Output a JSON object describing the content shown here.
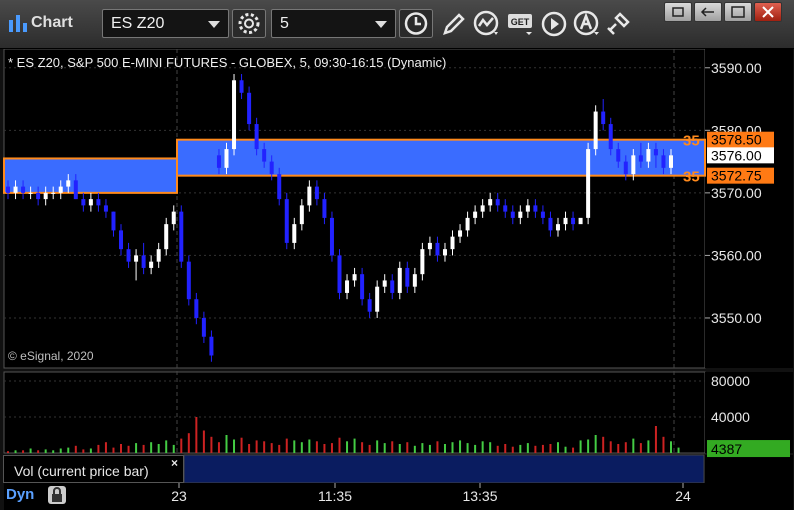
{
  "toolbar": {
    "app_title": "Chart",
    "symbol_value": "ES Z20",
    "interval_value": "5",
    "icons": [
      "chart-logo-icon",
      "settings-gear-icon",
      "clock-icon",
      "pencil-icon",
      "study-icon",
      "get-icon",
      "play-icon",
      "alert-icon",
      "link-icon"
    ]
  },
  "window_controls": [
    "restore-icon",
    "maximize-icon",
    "close-icon"
  ],
  "chart": {
    "symbol_title": "* ES Z20, S&P 500 E-MINI FUTURES - GLOBEX, 5, 09:30-16:15 (Dynamic)",
    "copyright": "© eSignal, 2020",
    "price_ticks": [
      "3590.00",
      "3580.00",
      "3570.00",
      "3560.00",
      "3550.00"
    ],
    "price_tag_high": "3578.50",
    "price_tag_current": "3576.00",
    "price_tag_low": "3572.75",
    "tag_prefix_high": "35",
    "tag_prefix_low": "35",
    "volume_ticks": [
      "80000",
      "40000"
    ],
    "volume_current": "4387",
    "time_labels": [
      "23",
      "11:35",
      "13:35",
      "24"
    ],
    "colors": {
      "up": "#ffffff",
      "down": "#2222ff",
      "band": "#3a6cff",
      "band_border": "#ff8a1c",
      "vol_up": "#44cc44",
      "vol_down": "#cc2222",
      "vol_tag": "#33aa22"
    }
  },
  "chart_data": {
    "type": "candlestick",
    "ylim": [
      3542,
      3593
    ],
    "candles": [
      [
        3571,
        3572,
        3569,
        3570
      ],
      [
        3570,
        3572,
        3569,
        3571
      ],
      [
        3571,
        3572,
        3569,
        3570
      ],
      [
        3570,
        3571,
        3569,
        3570
      ],
      [
        3570,
        3571,
        3568,
        3569
      ],
      [
        3569,
        3571,
        3568,
        3570
      ],
      [
        3570,
        3571,
        3569,
        3570
      ],
      [
        3570,
        3572,
        3569,
        3571
      ],
      [
        3571,
        3573,
        3570,
        3572
      ],
      [
        3572,
        3573,
        3569,
        3569
      ],
      [
        3569,
        3570,
        3567,
        3568
      ],
      [
        3568,
        3570,
        3567,
        3569
      ],
      [
        3569,
        3570,
        3567,
        3568
      ],
      [
        3568,
        3569,
        3566,
        3567
      ],
      [
        3567,
        3567,
        3563,
        3564
      ],
      [
        3564,
        3565,
        3560,
        3561
      ],
      [
        3561,
        3562,
        3558,
        3559
      ],
      [
        3559,
        3561,
        3556,
        3560
      ],
      [
        3560,
        3562,
        3557,
        3558
      ],
      [
        3558,
        3560,
        3557,
        3559
      ],
      [
        3559,
        3562,
        3558,
        3561
      ],
      [
        3561,
        3566,
        3560,
        3565
      ],
      [
        3565,
        3568,
        3564,
        3567
      ],
      [
        3567,
        3568,
        3558,
        3559
      ],
      [
        3559,
        3560,
        3552,
        3553
      ],
      [
        3553,
        3554,
        3549,
        3550
      ],
      [
        3550,
        3551,
        3546,
        3547
      ],
      [
        3547,
        3548,
        3543,
        3544
      ],
      [
        3576,
        3577,
        3573,
        3574
      ],
      [
        3574,
        3578,
        3573,
        3577
      ],
      [
        3577,
        3589,
        3576,
        3588
      ],
      [
        3588,
        3589,
        3585,
        3586
      ],
      [
        3586,
        3587,
        3580,
        3581
      ],
      [
        3581,
        3582,
        3576,
        3577
      ],
      [
        3577,
        3578,
        3574,
        3575
      ],
      [
        3575,
        3576,
        3572,
        3573
      ],
      [
        3573,
        3574,
        3568,
        3569
      ],
      [
        3569,
        3570,
        3561,
        3562
      ],
      [
        3562,
        3566,
        3561,
        3565
      ],
      [
        3565,
        3569,
        3564,
        3568
      ],
      [
        3568,
        3572,
        3567,
        3571
      ],
      [
        3571,
        3572,
        3568,
        3569
      ],
      [
        3569,
        3570,
        3565,
        3566
      ],
      [
        3566,
        3567,
        3559,
        3560
      ],
      [
        3560,
        3561,
        3553,
        3554
      ],
      [
        3554,
        3557,
        3553,
        3556
      ],
      [
        3556,
        3558,
        3555,
        3557
      ],
      [
        3557,
        3558,
        3552,
        3553
      ],
      [
        3553,
        3554,
        3550,
        3551
      ],
      [
        3551,
        3556,
        3550,
        3555
      ],
      [
        3555,
        3557,
        3554,
        3556
      ],
      [
        3556,
        3557,
        3553,
        3554
      ],
      [
        3554,
        3559,
        3553,
        3558
      ],
      [
        3558,
        3559,
        3554,
        3555
      ],
      [
        3555,
        3558,
        3554,
        3557
      ],
      [
        3557,
        3562,
        3556,
        3561
      ],
      [
        3561,
        3563,
        3560,
        3562
      ],
      [
        3562,
        3563,
        3559,
        3560
      ],
      [
        3560,
        3562,
        3559,
        3561
      ],
      [
        3561,
        3564,
        3560,
        3563
      ],
      [
        3563,
        3565,
        3562,
        3564
      ],
      [
        3564,
        3567,
        3563,
        3566
      ],
      [
        3566,
        3568,
        3565,
        3567
      ],
      [
        3567,
        3569,
        3566,
        3568
      ],
      [
        3568,
        3570,
        3567,
        3569
      ],
      [
        3569,
        3570,
        3567,
        3568
      ],
      [
        3568,
        3569,
        3566,
        3567
      ],
      [
        3567,
        3568,
        3565,
        3566
      ],
      [
        3566,
        3568,
        3565,
        3567
      ],
      [
        3567,
        3569,
        3566,
        3568
      ],
      [
        3568,
        3569,
        3566,
        3567
      ],
      [
        3567,
        3568,
        3565,
        3566
      ],
      [
        3566,
        3567,
        3563,
        3564
      ],
      [
        3564,
        3566,
        3563,
        3565
      ],
      [
        3565,
        3567,
        3564,
        3566
      ],
      [
        3566,
        3567,
        3564,
        3565
      ],
      [
        3565,
        3566,
        3566,
        3566
      ],
      [
        3566,
        3578,
        3565,
        3577
      ],
      [
        3577,
        3584,
        3576,
        3583
      ],
      [
        3583,
        3585,
        3580,
        3581
      ],
      [
        3581,
        3582,
        3576,
        3577
      ],
      [
        3577,
        3578,
        3574,
        3575
      ],
      [
        3575,
        3576,
        3572,
        3573
      ],
      [
        3573,
        3577,
        3572,
        3576
      ],
      [
        3576,
        3578,
        3574,
        3575
      ],
      [
        3575,
        3578,
        3574,
        3577
      ],
      [
        3577,
        3578,
        3574,
        3576
      ],
      [
        3576,
        3577,
        3573,
        3574
      ],
      [
        3574,
        3577,
        3573,
        3576
      ]
    ],
    "volumes": [
      2,
      3,
      3,
      5,
      3,
      4,
      3,
      5,
      6,
      8,
      4,
      5,
      9,
      12,
      6,
      10,
      8,
      11,
      9,
      12,
      10,
      14,
      9,
      16,
      22,
      40,
      25,
      18,
      12,
      20,
      15,
      17,
      10,
      14,
      13,
      11,
      9,
      16,
      14,
      12,
      15,
      13,
      10,
      11,
      17,
      13,
      16,
      12,
      9,
      14,
      11,
      13,
      10,
      12,
      8,
      11,
      9,
      13,
      10,
      12,
      14,
      11,
      9,
      13,
      12,
      8,
      10,
      7,
      9,
      11,
      8,
      9,
      10,
      12,
      7,
      6,
      14,
      15,
      20,
      18,
      13,
      10,
      12,
      16,
      11,
      14,
      30,
      18,
      13,
      6
    ],
    "band_1": [
      3570,
      3575.5
    ],
    "band_2": [
      3572.75,
      3578.5
    ]
  }
}
